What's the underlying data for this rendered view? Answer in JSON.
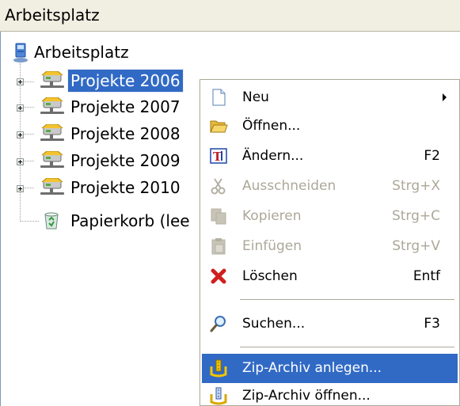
{
  "window": {
    "title": "Arbeitsplatz"
  },
  "tree": {
    "root": "Arbeitsplatz",
    "items": [
      {
        "label": "Projekte 2006",
        "selected": true
      },
      {
        "label": "Projekte 2007",
        "selected": false
      },
      {
        "label": "Projekte 2008",
        "selected": false
      },
      {
        "label": "Projekte 2009",
        "selected": false
      },
      {
        "label": "Projekte 2010",
        "selected": false
      },
      {
        "label": "Papierkorb (lee",
        "selected": false
      }
    ]
  },
  "context_menu": {
    "items": [
      {
        "label": "Neu",
        "shortcut": "",
        "has_submenu": true,
        "enabled": true,
        "icon": "new-document-icon"
      },
      {
        "label": "Öffnen...",
        "shortcut": "",
        "enabled": true,
        "icon": "open-folder-icon"
      },
      {
        "label": "Ändern...",
        "shortcut": "F2",
        "enabled": true,
        "icon": "rename-icon"
      },
      {
        "label": "Ausschneiden",
        "shortcut": "Strg+X",
        "enabled": false,
        "icon": "scissors-icon"
      },
      {
        "label": "Kopieren",
        "shortcut": "Strg+C",
        "enabled": false,
        "icon": "copy-icon"
      },
      {
        "label": "Einfügen",
        "shortcut": "Strg+V",
        "enabled": false,
        "icon": "paste-icon"
      },
      {
        "label": "Löschen",
        "shortcut": "Entf",
        "enabled": true,
        "icon": "delete-icon"
      },
      {
        "label": "Suchen...",
        "shortcut": "F3",
        "enabled": true,
        "icon": "search-icon"
      },
      {
        "label": "Zip-Archiv anlegen...",
        "shortcut": "",
        "enabled": true,
        "highlighted": true,
        "icon": "zip-create-icon"
      },
      {
        "label": "Zip-Archiv öffnen...",
        "shortcut": "",
        "enabled": true,
        "icon": "zip-open-icon"
      }
    ]
  },
  "colors": {
    "selection": "#316ac5",
    "disabled_text": "#aca899",
    "title_bar": "#f1efe2"
  }
}
